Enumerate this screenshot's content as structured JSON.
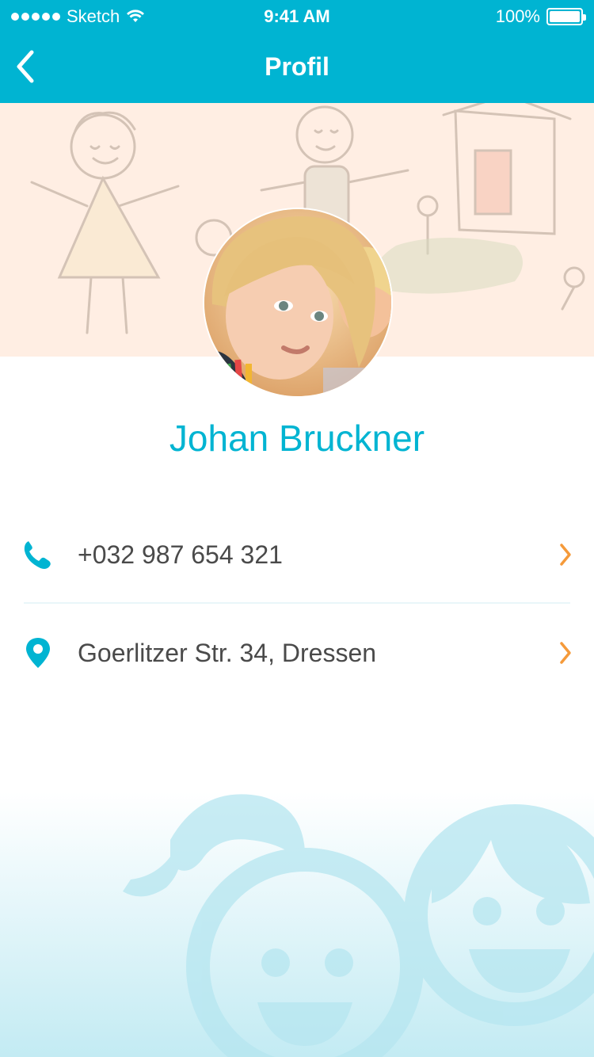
{
  "status_bar": {
    "carrier": "Sketch",
    "time": "9:41 AM",
    "battery": "100%"
  },
  "nav": {
    "title": "Profil"
  },
  "profile": {
    "name": "Johan Bruckner"
  },
  "contacts": [
    {
      "icon": "phone-icon",
      "value": "+032 987 654 321"
    },
    {
      "icon": "location-pin-icon",
      "value": "Goerlitzer Str. 34, Dressen"
    }
  ],
  "colors": {
    "accent": "#00b4d2",
    "chevron": "#f59a3a",
    "hero_bg": "#ffeee3",
    "text": "#4a4a4a"
  }
}
